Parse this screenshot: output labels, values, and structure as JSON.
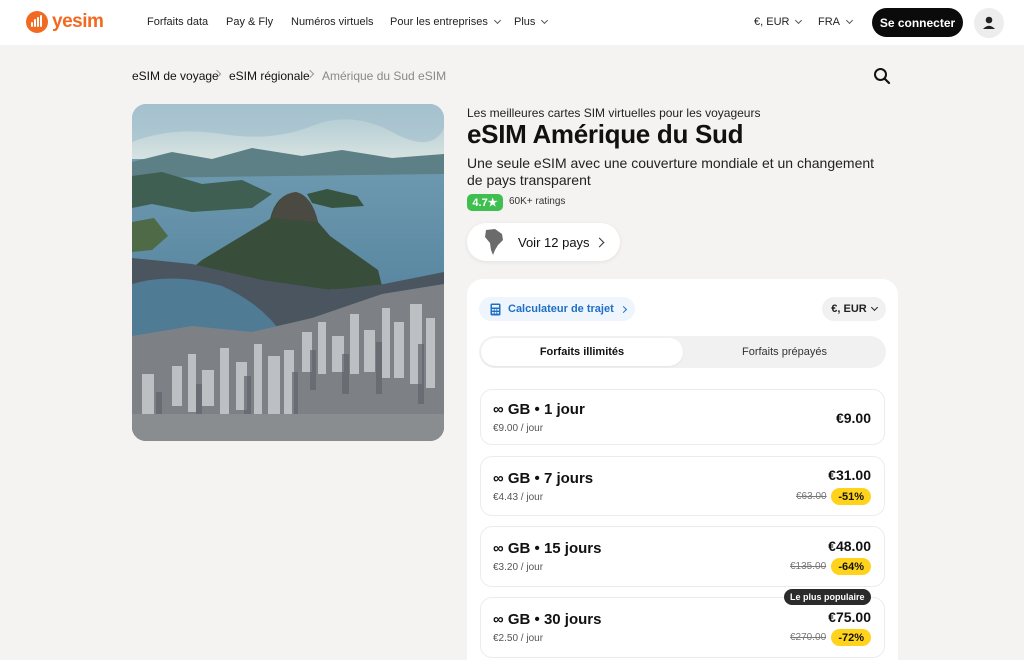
{
  "header": {
    "logo_text": "yesim",
    "nav": [
      "Forfaits data",
      "Pay & Fly",
      "Numéros virtuels",
      "Pour les entreprises",
      "Plus"
    ],
    "currency": "€, EUR",
    "language": "FRA",
    "login_label": "Se connecter"
  },
  "breadcrumb": [
    "eSIM de voyage",
    "eSIM régionale",
    "Amérique du Sud eSIM"
  ],
  "product": {
    "tagline": "Les meilleures cartes SIM virtuelles pour les voyageurs",
    "title": "eSIM Amérique du Sud",
    "description": "Une seule eSIM avec une couverture mondiale et un changement de pays transparent",
    "rating": "4.7★",
    "ratings_count": "60K+ ratings",
    "countries_button": "Voir 12 pays"
  },
  "card": {
    "calculator_label": "Calculateur de trajet",
    "currency_pill": "€, EUR",
    "tabs": [
      "Forfaits illimités",
      "Forfaits prépayés"
    ],
    "plans": [
      {
        "title": "∞ GB • 1 jour",
        "per_day": "€9.00 / jour",
        "price": "€9.00",
        "old_price": "",
        "discount": "",
        "badge": ""
      },
      {
        "title": "∞ GB • 7 jours",
        "per_day": "€4.43 / jour",
        "price": "€31.00",
        "old_price": "€63.00",
        "discount": "-51%",
        "badge": ""
      },
      {
        "title": "∞ GB • 15 jours",
        "per_day": "€3.20 / jour",
        "price": "€48.00",
        "old_price": "€135.00",
        "discount": "-64%",
        "badge": ""
      },
      {
        "title": "∞ GB • 30 jours",
        "per_day": "€2.50 / jour",
        "price": "€75.00",
        "old_price": "€270.00",
        "discount": "-72%",
        "badge": "Le plus populaire"
      }
    ]
  },
  "colors": {
    "brand": "#f26a21",
    "rating_green": "#3fbf4f",
    "discount_yellow": "#ffd21c",
    "link_blue": "#1f6fc5"
  }
}
